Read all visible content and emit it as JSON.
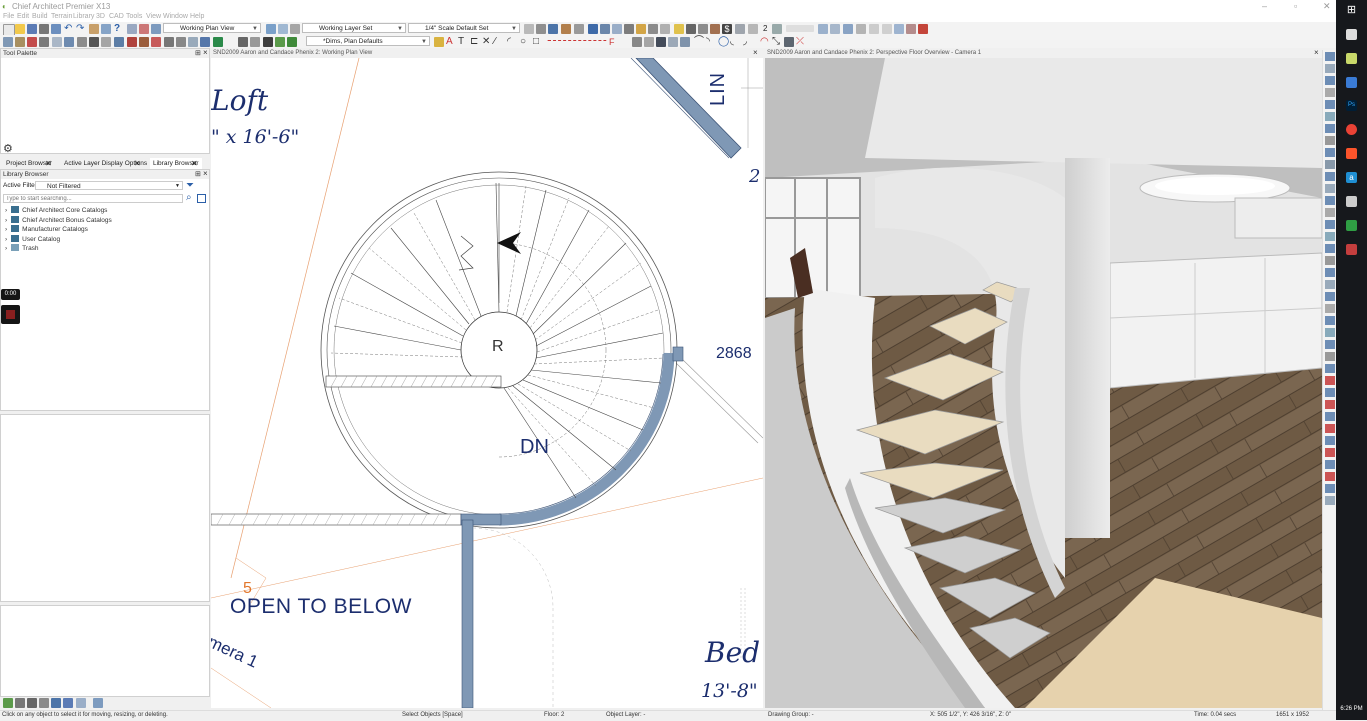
{
  "app": {
    "title": "Chief Architect Premier X13",
    "menu": [
      "File",
      "Edit",
      "Build",
      "Terrain",
      "Library",
      "3D",
      "CAD",
      "Tools",
      "View",
      "Window",
      "Help"
    ]
  },
  "toolbar": {
    "plan_view_combo": "Working Plan View",
    "layer_set_combo": "Working Layer Set",
    "scale_combo": "1/4\" Scale Default Set",
    "defaults_combo": "*Dims, Plan Defaults",
    "number_box": "2"
  },
  "left": {
    "tool_palette_title": "Tool Palette",
    "tabs": [
      "Project Browser",
      "Active Layer Display Options",
      "Library Browser"
    ],
    "library_title": "Library Browser",
    "active_filter_label": "Active Filter:",
    "active_filter_value": "Not Filtered",
    "search_placeholder": "Type to start searching...",
    "tree": [
      "Chief Architect Core Catalogs",
      "Chief Architect Bonus Catalogs",
      "Manufacturer Catalogs",
      "User Catalog",
      "Trash"
    ]
  },
  "recorder": {
    "time": "0:00"
  },
  "plan_view": {
    "tab_title": "SND2009 Aaron and Candace Phenix 2: Working Plan View",
    "labels": {
      "loft": "Loft",
      "loft_dim": "\" x 16'-6\"",
      "lin": "LIN",
      "two": "2",
      "r": "R",
      "dn": "DN",
      "num": "2868",
      "open": "OPEN TO BELOW",
      "cam": "mera 1",
      "five": "5",
      "bed": "Bed",
      "bed_dim": "13'-8\""
    }
  },
  "camera_view": {
    "tab_title": "SND2009 Aaron and Candace Phenix 2: Perspective Floor Overview - Camera 1"
  },
  "status": {
    "hint": "Click on any object to select it for moving, resizing, or deleting.",
    "mode": "Select Objects [Space]",
    "floor": "Floor: 2",
    "object_layer": "Object Layer: -",
    "drawing_group": "Drawing Group: -",
    "coords": "X: 505 1/2\", Y: 426 3/16\", Z: 0\"",
    "time": "Time: 0.04 secs",
    "size": "1651 x 1952"
  },
  "taskbar": {
    "clock": "6:26 PM"
  },
  "colors": {
    "wall_blue": "#7f98b5",
    "plan_text": "#1c2e6e",
    "orange": "#e2772c"
  }
}
